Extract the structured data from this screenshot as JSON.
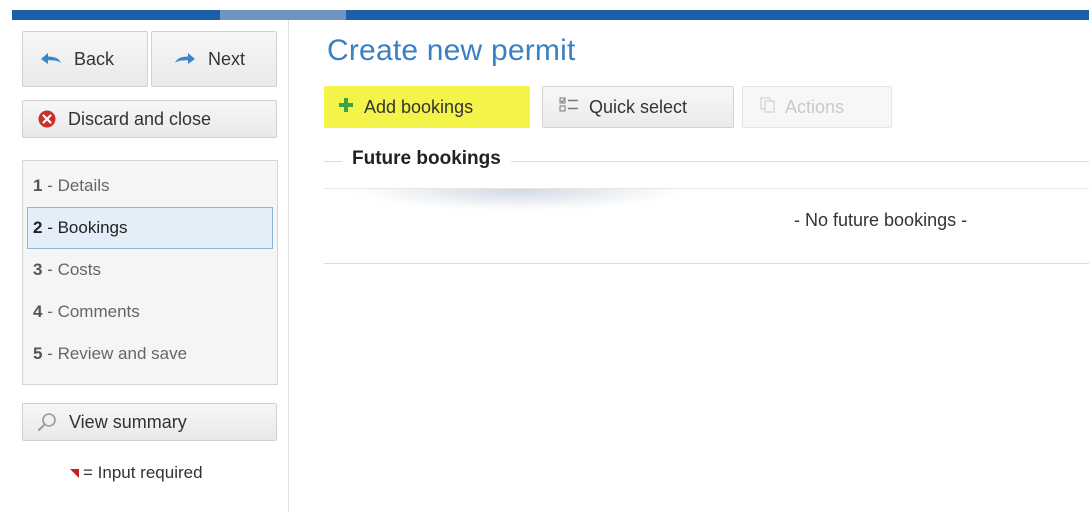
{
  "nav": {
    "back_label": "Back",
    "next_label": "Next",
    "discard_label": "Discard and close"
  },
  "steps": [
    {
      "num": "1",
      "label": "Details"
    },
    {
      "num": "2",
      "label": "Bookings"
    },
    {
      "num": "3",
      "label": "Costs"
    },
    {
      "num": "4",
      "label": "Comments"
    },
    {
      "num": "5",
      "label": "Review and save"
    }
  ],
  "step_separator": " - ",
  "summary": {
    "label": "View summary"
  },
  "legend": {
    "text": "= Input required"
  },
  "page": {
    "title": "Create new permit"
  },
  "toolbar": {
    "add_label": "Add bookings",
    "quick_label": "Quick select",
    "actions_label": "Actions"
  },
  "section": {
    "title": "Future bookings",
    "empty_text": "- No future bookings -"
  },
  "colors": {
    "topbar": "#1c5ea7",
    "title": "#3b7fc4",
    "highlight": "#f4f34a",
    "active_step_bg": "#e3eef9",
    "required_marker": "#c0211f"
  },
  "icons": {
    "back": "arrow-left-icon",
    "next": "arrow-right-icon",
    "discard": "close-circle-icon",
    "summary": "magnifier-icon",
    "add": "plus-icon",
    "quick": "checklist-icon",
    "actions": "copy-icon"
  }
}
